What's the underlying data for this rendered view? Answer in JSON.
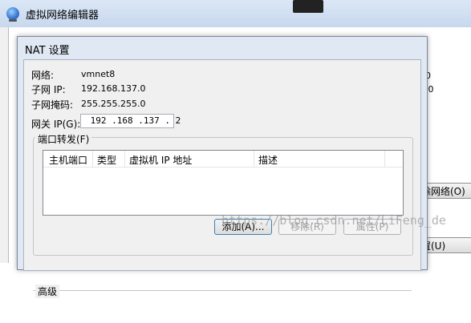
{
  "background_window": {
    "title": "虚拟网络编辑器",
    "remove_network_button": "除网络(O)",
    "reset_button": "置(U)",
    "right_values": [
      "0",
      ".0"
    ]
  },
  "nat_dialog": {
    "title": "NAT 设置",
    "info": {
      "network_label": "网络:",
      "network_value": "vmnet8",
      "subnet_ip_label": "子网 IP:",
      "subnet_ip_value": "192.168.137.0",
      "subnet_mask_label": "子网掩码:",
      "subnet_mask_value": "255.255.255.0"
    },
    "gateway": {
      "label": "网关 IP(G):",
      "value": " 192 .168 .137 . 2"
    },
    "port_forwarding": {
      "title": "端口转发(F)",
      "columns": [
        "主机端口",
        "类型",
        "虚拟机 IP 地址",
        "描述"
      ],
      "rows": [],
      "buttons": {
        "add": "添加(A)...",
        "remove": "移除(R)",
        "properties": "属性(P)"
      }
    },
    "advanced_label": "高级"
  },
  "watermark": "https://blog.csdn.net/LiFeng_de"
}
